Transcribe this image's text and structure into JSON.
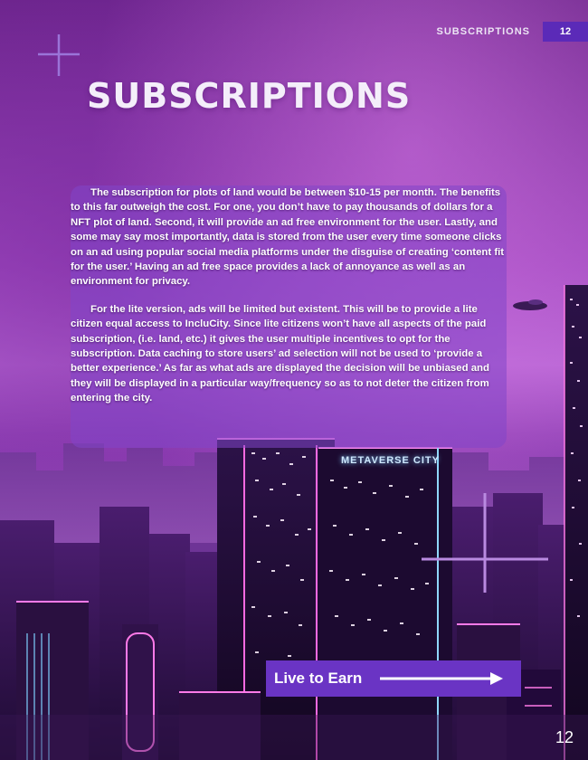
{
  "header": {
    "section_label": "SUBSCRIPTIONS",
    "page_badge": "12"
  },
  "title": "SUBSCRIPTIONS",
  "body": {
    "paragraph_1": "The subscription for plots of land would be between $10-15 per month. The benefits to this far outweigh the cost. For one, you don’t have to pay thousands of dollars for a NFT plot of land. Second, it will provide an ad free environment for the user. Lastly, and some may say most importantly, data is stored from the user every time someone clicks on an ad using popular social media platforms under the disguise of creating ‘content fit for the user.’ Having an ad free space provides a lack of annoyance as well as an environment for privacy.",
    "paragraph_2": "For the lite version, ads will be limited but existent. This will be to provide a lite citizen equal access to IncluCity. Since lite citizens won’t have all aspects of the paid subscription, (i.e. land, etc.) it gives the user multiple incentives to opt for the subscription. Data caching to store users’ ad selection will not be used to ‘provide a better experience.’ As far as what ads are displayed the decision will be unbiased and they will be displayed in a particular way/frequency so as to not deter the citizen from entering the city."
  },
  "building_sign": "METAVERSE CITY",
  "cta": {
    "label": "Live to Earn",
    "icon": "arrow-right-icon"
  },
  "page_number": "12",
  "colors": {
    "accent": "#5b2ab8",
    "cta_bg": "#6a34c4",
    "panel": "#8246c8"
  }
}
